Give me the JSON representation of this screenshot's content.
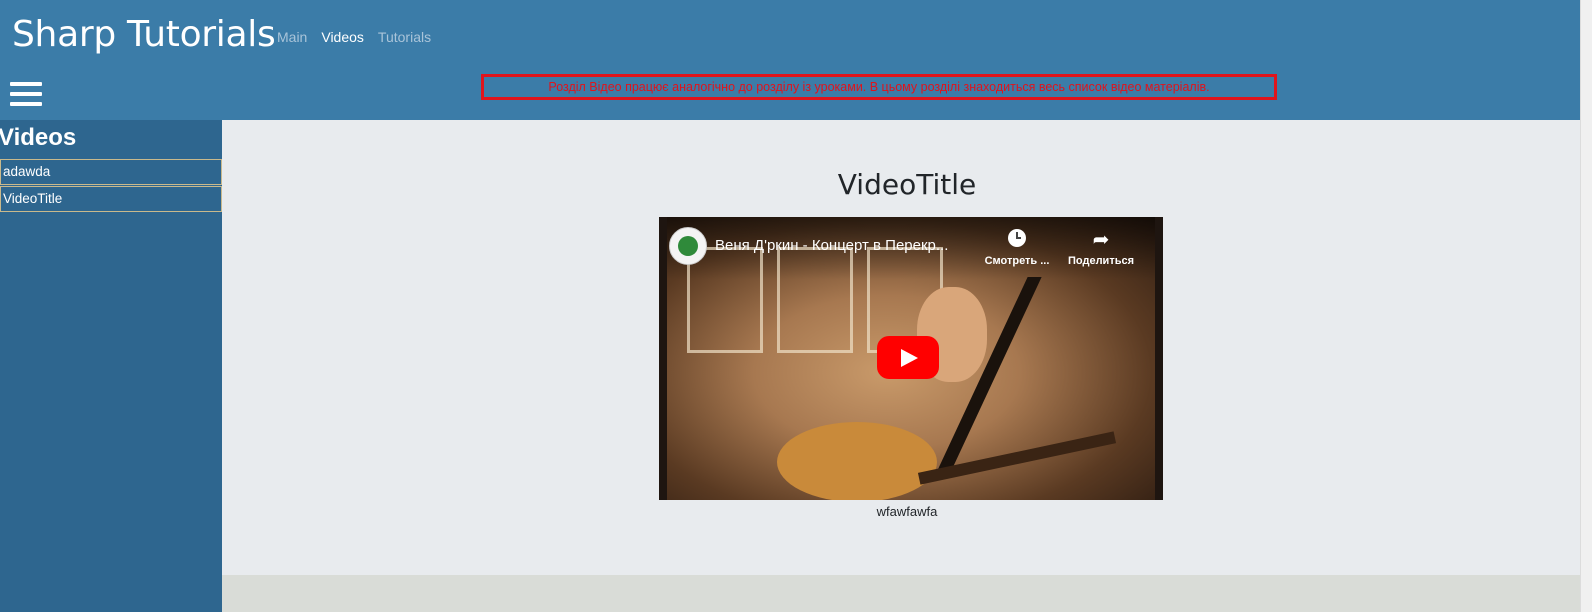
{
  "header": {
    "brand": "Sharp Tutorials",
    "nav": [
      {
        "label": "Main",
        "active": false
      },
      {
        "label": "Videos",
        "active": true
      },
      {
        "label": "Tutorials",
        "active": false
      }
    ],
    "notice": "Розділ Відео працює аналогічно до розділу із уроками. В цьому розділі знаходиться весь список відео матеріалів.",
    "menu_icon": "hamburger-icon"
  },
  "sidebar": {
    "title": "Videos",
    "items": [
      {
        "label": "adawda"
      },
      {
        "label": "VideoTitle"
      }
    ]
  },
  "main": {
    "video_title": "VideoTitle",
    "caption": "wfawfawfa",
    "player": {
      "video_title": "Веня Д'ркин - Концерт в Перекр...",
      "watch_later_label": "Смотреть ...",
      "share_label": "Поделиться",
      "play_icon": "play-icon",
      "clock_icon": "clock-icon",
      "share_icon": "share-icon"
    }
  },
  "colors": {
    "navbar": "#3b7ca8",
    "sidebar": "#2e668f",
    "main_bg": "#e8ebee",
    "notice_red": "#e0141c",
    "play_red": "#ff0000"
  }
}
